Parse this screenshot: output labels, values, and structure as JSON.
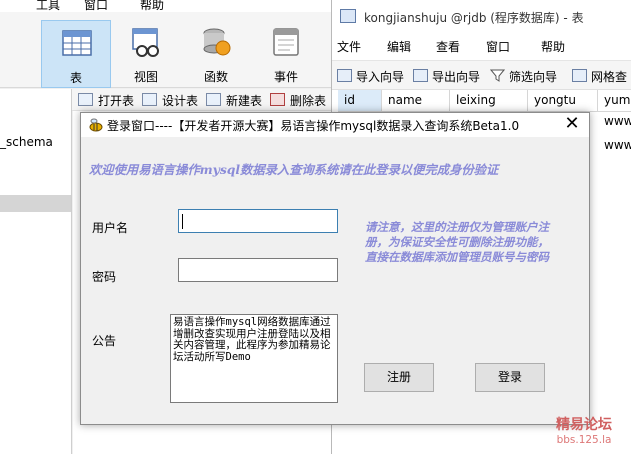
{
  "navicat": {
    "menu": [
      "工具",
      "窗口",
      "帮助"
    ],
    "ribbon": [
      {
        "label": "表",
        "icon": "table-icon",
        "selected": true
      },
      {
        "label": "视图",
        "icon": "view-icon",
        "selected": false
      },
      {
        "label": "函数",
        "icon": "function-icon",
        "selected": false
      },
      {
        "label": "事件",
        "icon": "event-icon",
        "selected": false
      }
    ],
    "subtoolbar": [
      "打开表",
      "设计表",
      "新建表",
      "删除表"
    ],
    "tree": {
      "schema_item": "_schema"
    }
  },
  "table_window": {
    "title": "kongjianshuju @rjdb (程序数据库) - 表",
    "menu": [
      "文件",
      "编辑",
      "查看",
      "窗口",
      "帮助"
    ],
    "toolbar": [
      "导入向导",
      "导出向导",
      "筛选向导",
      "网格查"
    ],
    "columns": [
      "id",
      "name",
      "leixing",
      "yongtu",
      "yumi"
    ],
    "rows": [
      [
        "www"
      ],
      [
        "www"
      ]
    ]
  },
  "dialog": {
    "title": "登录窗口----【开发者开源大赛】易语言操作mysql数据录入查询系统Beta1.0",
    "close": "✕",
    "welcome": "欢迎使用易语言操作mysql数据录入查询系统请在此登录以便完成身份验证",
    "username_label": "用户名",
    "password_label": "密码",
    "username_value": "",
    "password_value": "",
    "notice_label": "公告",
    "notice_text": "易语言操作mysql网络数据库通过增删改查实现用户注册登陆以及相关内容管理，此程序为参加精易论坛活动所写Demo",
    "side_note": "请注意，这里的注册仅为管理账户注册，为保证安全性可删除注册功能，直接在数据库添加管理员账号与密码",
    "register_button": "注册",
    "login_button": "登录"
  },
  "watermark": {
    "line1": "精易论坛",
    "line2": "bbs.125.la"
  },
  "colors": {
    "accent_text": "#8a8bd8",
    "selected_ribbon": "#cce4f7"
  }
}
